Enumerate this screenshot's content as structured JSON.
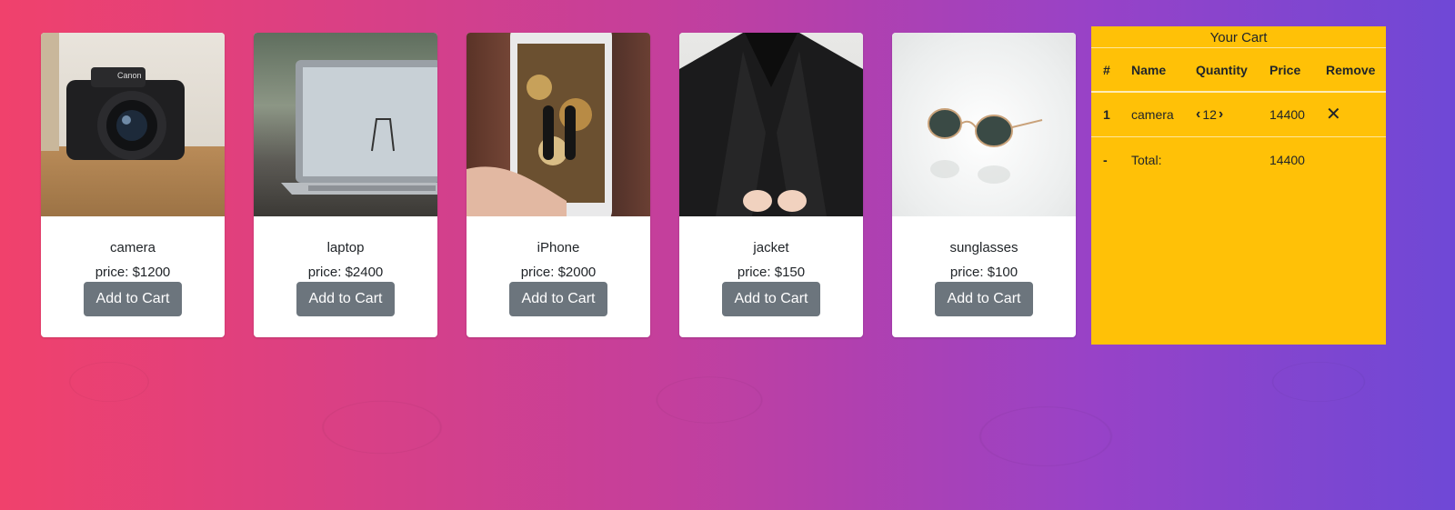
{
  "products": [
    {
      "name": "camera",
      "price": "price: $1200",
      "button": "Add to Cart",
      "icon": "camera-photo"
    },
    {
      "name": "laptop",
      "price": "price: $2400",
      "button": "Add to Cart",
      "icon": "laptop-photo"
    },
    {
      "name": "iPhone",
      "price": "price: $2000",
      "button": "Add to Cart",
      "icon": "iphone-photo"
    },
    {
      "name": "jacket",
      "price": "price: $150",
      "button": "Add to Cart",
      "icon": "jacket-photo"
    },
    {
      "name": "sunglasses",
      "price": "price: $100",
      "button": "Add to Cart",
      "icon": "sunglasses-photo"
    }
  ],
  "cart": {
    "title": "Your Cart",
    "headers": {
      "idx": "#",
      "name": "Name",
      "quantity": "Quantity",
      "price": "Price",
      "remove": "Remove"
    },
    "items": [
      {
        "idx": "1",
        "name": "camera",
        "quantity": "12",
        "price": "14400",
        "remove_icon": "close-icon"
      }
    ],
    "total": {
      "idx": "-",
      "label": "Total:",
      "price": "14400"
    }
  },
  "colors": {
    "cart_bg": "#ffc107",
    "button_bg": "#6c757d",
    "gradient_start": "#f0416c",
    "gradient_end": "#6f48d6"
  }
}
